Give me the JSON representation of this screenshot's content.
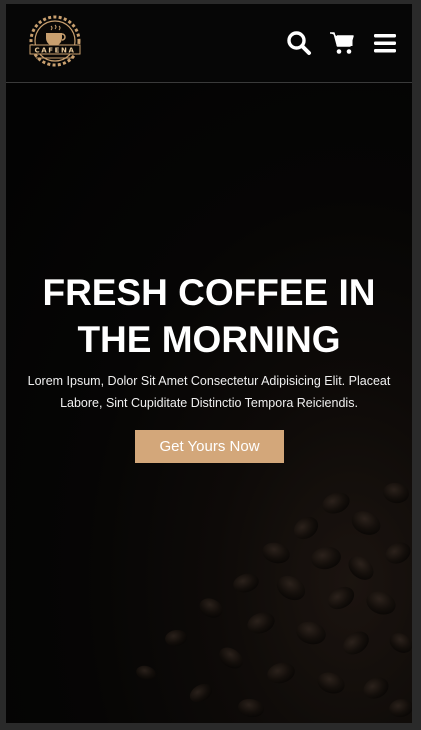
{
  "header": {
    "logo_text": "CAFENA",
    "icons": [
      "search-icon",
      "cart-icon",
      "menu-icon"
    ]
  },
  "hero": {
    "title_line1": "FRESH COFFEE IN",
    "title_line2": "THE MORNING",
    "description_line1": "Lorem Ipsum, Dolor Sit Amet Consectetur Adipisicing Elit. Placeat",
    "description_line2": "Labore, Sint Cupiditate Distinctio Tempora Reiciendis.",
    "cta_label": "Get Yours Now"
  },
  "colors": {
    "accent": "#d3a77a",
    "header_bg": "#060606",
    "hero_bg": "#0a0a0a",
    "text": "#ffffff"
  }
}
